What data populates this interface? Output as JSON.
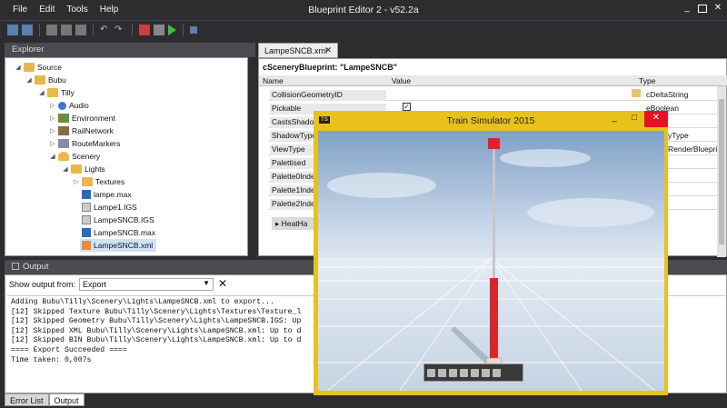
{
  "app": {
    "title": "Blueprint Editor 2 - v52.2a",
    "menu": [
      "File",
      "Edit",
      "Tools",
      "Help"
    ],
    "window_controls": [
      "_",
      "□",
      "✕"
    ]
  },
  "explorer": {
    "title": "Explorer",
    "tree": [
      {
        "label": "Source",
        "expanded": true,
        "icon": "folder-icon"
      },
      {
        "label": "Bubu",
        "expanded": true,
        "icon": "folder-icon"
      },
      {
        "label": "Tilly",
        "expanded": true,
        "icon": "folder-icon"
      },
      {
        "label": "Audio",
        "expanded": false,
        "icon": "audio-icon"
      },
      {
        "label": "Environment",
        "expanded": false,
        "icon": "environment-icon"
      },
      {
        "label": "RailNetwork",
        "expanded": false,
        "icon": "railnetwork-icon"
      },
      {
        "label": "RouteMarkers",
        "expanded": false,
        "icon": "routemarkers-icon"
      },
      {
        "label": "Scenery",
        "expanded": true,
        "icon": "scenery-icon"
      },
      {
        "label": "Lights",
        "expanded": true,
        "icon": "folder-icon"
      },
      {
        "label": "Textures",
        "expanded": false,
        "icon": "folder-icon"
      },
      {
        "label": "lampe.max",
        "icon": "max-file-icon"
      },
      {
        "label": "Lampe1.IGS",
        "icon": "igs-file-icon"
      },
      {
        "label": "LampeSNCB.IGS",
        "icon": "igs-file-icon"
      },
      {
        "label": "LampeSNCB.max",
        "icon": "max-file-icon"
      },
      {
        "label": "LampeSNCB.xml",
        "icon": "xml-file-icon",
        "selected": true
      }
    ]
  },
  "document": {
    "tab_label": "LampeSNCB.xml",
    "tab_close": "✕",
    "blueprint_title": "cSceneryBlueprint: \"LampeSNCB\"",
    "columns": [
      "Name",
      "Value",
      "Type"
    ],
    "rows": [
      {
        "name": "CollisionGeometryID",
        "type": "cDeltaString"
      },
      {
        "name": "Pickable",
        "type": "eBoolean",
        "checked": true
      },
      {
        "name": "CastsShadow",
        "type": ""
      },
      {
        "name": "ShadowType",
        "type": "yType"
      },
      {
        "name": "ViewType",
        "type": "RenderBluepri"
      },
      {
        "name": "Palettised",
        "type": ""
      },
      {
        "name": "Palette0Inde",
        "type": ""
      },
      {
        "name": "Palette1Inde",
        "type": ""
      },
      {
        "name": "Palette2Inde",
        "type": ""
      }
    ],
    "subsection": "HeatHa"
  },
  "output": {
    "title": "Output",
    "show_from_label": "Show output from:",
    "show_from_value": "Export",
    "log_lines": [
      "Adding Bubu\\Tilly\\Scenery\\Lights\\LampeSNCB.xml to export...",
      "[12] Skipped Texture Bubu\\Tilly\\Scenery\\Lights\\Textures\\Texture_l",
      "[12] Skipped Geometry Bubu\\Tilly\\Scenery\\Lights\\LampeSNCB.IGS: Up",
      "[12] Skipped XML Bubu\\Tilly\\Scenery\\Lights\\LampeSNCB.xml: Up to d",
      "[12] Skipped BIN Bubu\\Tilly\\Scenery\\Lights\\LampeSNCB.xml: Up to d",
      "==== Export Succeeded ====",
      "Time taken: 0,007s"
    ],
    "tabs": [
      "Error List",
      "Output"
    ]
  },
  "ts_window": {
    "title": "Train Simulator 2015",
    "logo": "TS",
    "controls": [
      "_",
      "□",
      "✕"
    ]
  }
}
